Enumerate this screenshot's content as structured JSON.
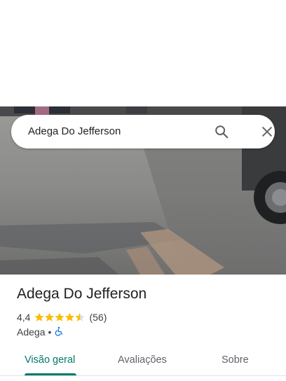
{
  "search": {
    "query": "Adega Do Jefferson"
  },
  "place": {
    "name": "Adega Do Jefferson",
    "rating": "4,4",
    "rating_value": 4.4,
    "reviews": "(56)",
    "category": "Adega",
    "separator": "•"
  },
  "icons": {
    "search": "search-icon",
    "close": "close-icon",
    "accessibility": "wheelchair-icon"
  },
  "tabs": [
    {
      "label": "Visão geral",
      "active": true
    },
    {
      "label": "Avaliações",
      "active": false
    },
    {
      "label": "Sobre",
      "active": false
    }
  ],
  "colors": {
    "accent": "#00796b",
    "star": "#fbbc04",
    "accessibility": "#1a73e8"
  }
}
